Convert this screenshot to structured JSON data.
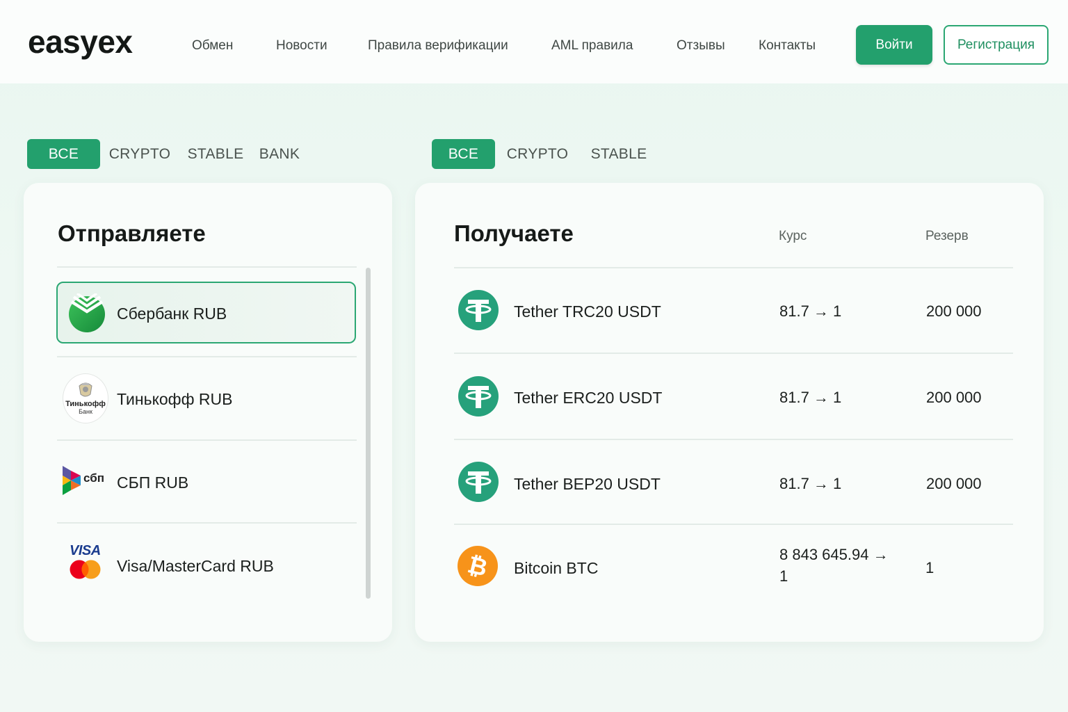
{
  "header": {
    "logo": "easyex",
    "nav": [
      "Обмен",
      "Новости",
      "Правила верификации",
      "AML правила",
      "Отзывы",
      "Контакты"
    ],
    "login_label": "Войти",
    "register_label": "Регистрация"
  },
  "send_tabs": [
    "ВСЕ",
    "CRYPTO",
    "STABLE",
    "BANK"
  ],
  "receive_tabs": [
    "ВСЕ",
    "CRYPTO",
    "STABLE"
  ],
  "send_panel": {
    "title": "Отправляете",
    "items": [
      {
        "name": "Сбербанк RUB",
        "icon": "sberbank-icon",
        "selected": true
      },
      {
        "name": "Тинькофф RUB",
        "icon": "tinkoff-icon",
        "selected": false
      },
      {
        "name": "СБП RUB",
        "icon": "sbp-icon",
        "selected": false
      },
      {
        "name": "Visa/MasterCard RUB",
        "icon": "visa-mastercard-icon",
        "selected": false
      }
    ],
    "tinkoff_logo_text": "Тинькофф",
    "tinkoff_logo_sub": "Банк",
    "sbp_logo_text": "сбп",
    "visa_logo_text": "VISA"
  },
  "receive_panel": {
    "title": "Получаете",
    "col_rate": "Курс",
    "col_reserve": "Резерв",
    "rows": [
      {
        "name": "Tether TRC20 USDT",
        "icon": "tether-icon",
        "rate": "81.7 → 1",
        "reserve": "200 000"
      },
      {
        "name": "Tether ERC20 USDT",
        "icon": "tether-icon",
        "rate": "81.7 → 1",
        "reserve": "200 000"
      },
      {
        "name": "Tether BEP20 USDT",
        "icon": "tether-icon",
        "rate": "81.7 → 1",
        "reserve": "200 000"
      },
      {
        "name": "Bitcoin BTC",
        "icon": "bitcoin-icon",
        "rate_line1": "8 843 645.94 →",
        "rate_line2": "1",
        "reserve": "1"
      }
    ]
  },
  "colors": {
    "accent": "#23a06d",
    "tether": "#26a17b",
    "bitcoin": "#f7931a",
    "sberbank": "#21a038"
  }
}
